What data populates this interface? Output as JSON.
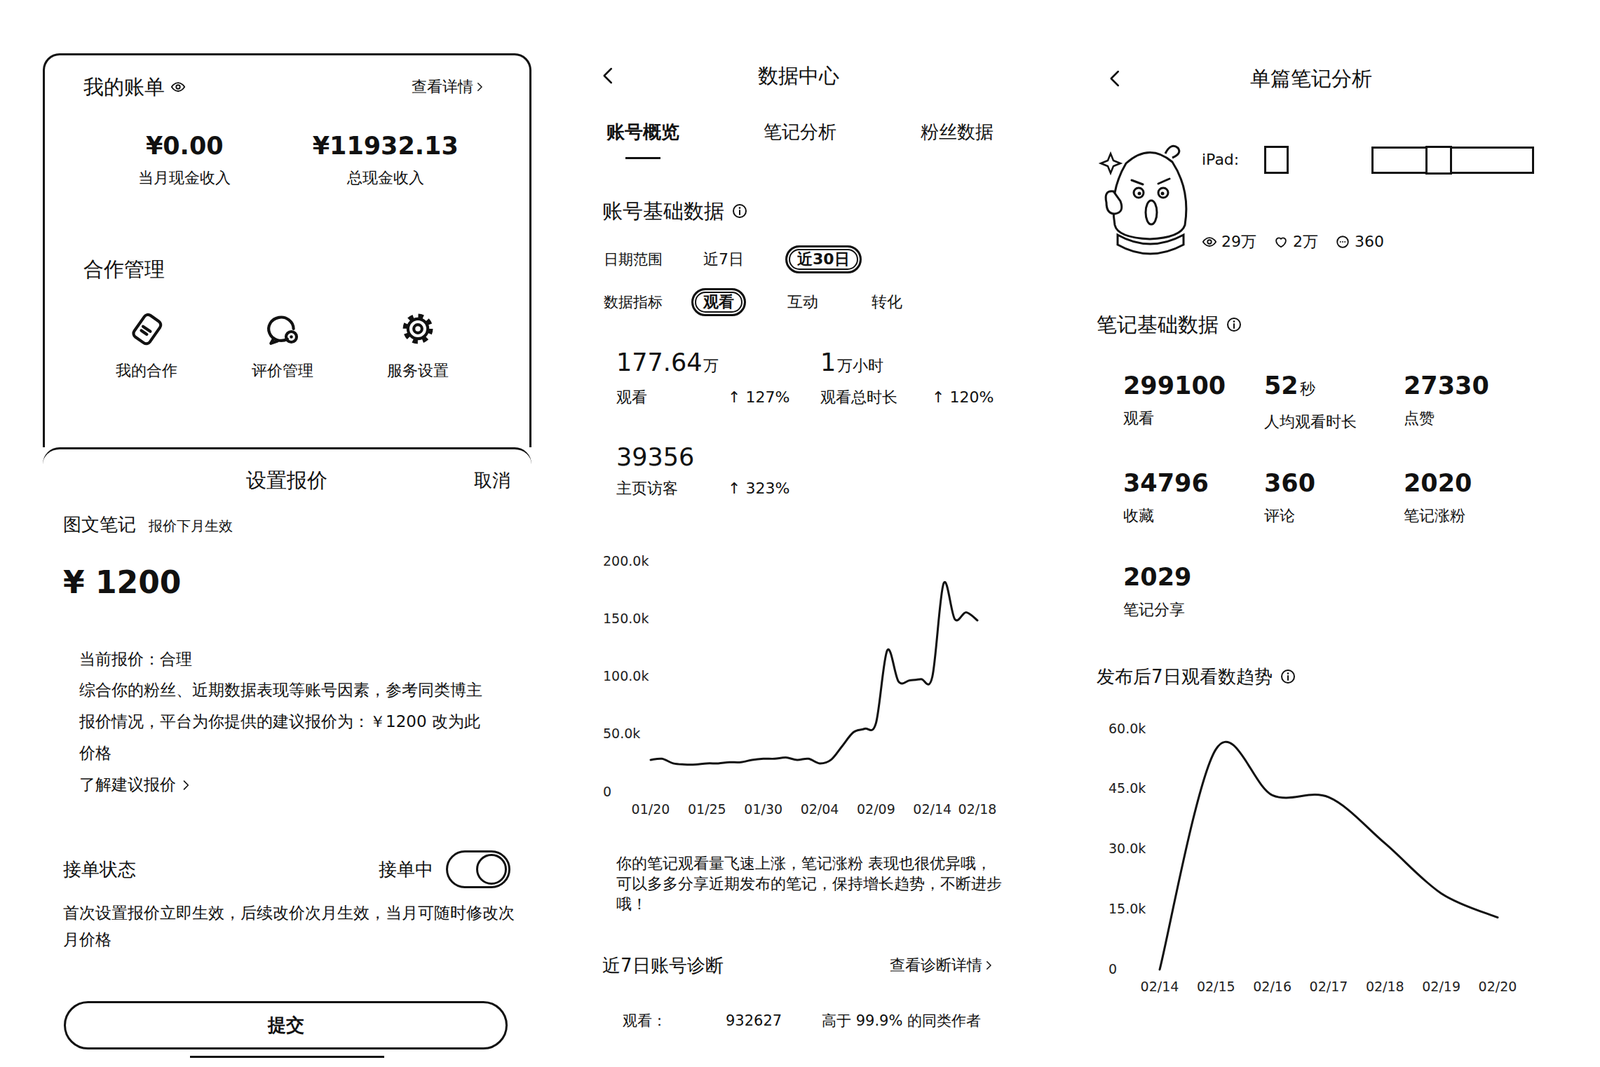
{
  "bill": {
    "title": "我的账单",
    "detail_link": "查看详情",
    "stats": [
      {
        "value": "¥0.00",
        "label": "当月现金收入"
      },
      {
        "value": "¥11932.13",
        "label": "总现金收入"
      }
    ],
    "section_title": "合作管理",
    "actions": [
      {
        "label": "我的合作"
      },
      {
        "label": "评价管理"
      },
      {
        "label": "服务设置"
      }
    ]
  },
  "quote_sheet": {
    "title": "设置报价",
    "cancel": "取消",
    "note_type": "图文笔记",
    "note_type_hint": "报价下月生效",
    "price": "¥ 1200",
    "assessment": "当前报价：合理",
    "suggestion": "综合你的粉丝、近期数据表现等账号因素，参考同类博主报价情况，平台为你提供的建议报价为：￥1200 ",
    "apply_link": "改为此价格",
    "learn_link": "了解建议报价",
    "order_status_label": "接单状态",
    "order_status_text": "接单中",
    "accepting_orders": true,
    "rule": "首次设置报价立即生效，后续改价次月生效，当月可随时修改次月价格",
    "submit": "提交"
  },
  "data_center": {
    "title": "数据中心",
    "tabs": [
      {
        "label": "账号概览",
        "selected": true
      },
      {
        "label": "笔记分析",
        "selected": false
      },
      {
        "label": "粉丝数据",
        "selected": false
      }
    ],
    "section_title": "账号基础数据",
    "date_range": {
      "label": "日期范围",
      "options": [
        {
          "label": "近7日",
          "selected": false
        },
        {
          "label": "近30日",
          "selected": true
        }
      ]
    },
    "metric": {
      "label": "数据指标",
      "options": [
        {
          "label": "观看",
          "selected": true
        },
        {
          "label": "互动",
          "selected": false
        },
        {
          "label": "转化",
          "selected": false
        }
      ]
    },
    "stats": [
      {
        "value": "177.64",
        "unit": "万",
        "label": "观看",
        "change": "↑ 127%"
      },
      {
        "value": "1",
        "unit": "万小时",
        "label": "观看总时长",
        "change": "↑ 120%"
      },
      {
        "value": "39356",
        "label": "主页访客",
        "change": "↑ 323%"
      }
    ],
    "chart": {
      "y_ticks": [
        "200.0k",
        "150.0k",
        "100.0k",
        "50.0k",
        "0"
      ],
      "x_ticks": [
        "01/20",
        "01/25",
        "01/30",
        "02/04",
        "02/09",
        "02/14",
        "02/18"
      ],
      "values": [
        28,
        29,
        25,
        24,
        24,
        25,
        25,
        26,
        26,
        28,
        29,
        29,
        30,
        28,
        29,
        25,
        28,
        40,
        52,
        55,
        60,
        123,
        96,
        97,
        98,
        100,
        181,
        150,
        156,
        149
      ]
    },
    "summary": "你的笔记观看量飞速上涨，笔记涨粉 表现也很优异哦，可以多多分享近期发布的笔记，保持增长趋势，不断进步哦！",
    "diagnosis": {
      "title": "近7日账号诊断",
      "link": "查看诊断详情",
      "rows": [
        {
          "metric": "观看：",
          "value": "932627",
          "comparison": "高于 99.9% 的同类作者"
        }
      ]
    }
  },
  "note_analysis": {
    "title": "单篇笔记分析",
    "note": {
      "title": "iPad:",
      "counts": [
        {
          "value": "29万"
        },
        {
          "value": "2万"
        },
        {
          "value": "360"
        }
      ]
    },
    "section_title": "笔记基础数据",
    "metrics": [
      {
        "value": "299100",
        "label": "观看"
      },
      {
        "value": "52",
        "unit": "秒",
        "label": "人均观看时长"
      },
      {
        "value": "27330",
        "label": "点赞"
      },
      {
        "value": "34796",
        "label": "收藏"
      },
      {
        "value": "360",
        "label": "评论"
      },
      {
        "value": "2020",
        "label": "笔记涨粉"
      },
      {
        "value": "2029",
        "label": "笔记分享"
      }
    ],
    "trend": {
      "title": "发布后7日观看数趋势",
      "y_ticks": [
        "60.0k",
        "45.0k",
        "30.0k",
        "15.0k",
        "0"
      ],
      "x_ticks": [
        "02/14",
        "02/15",
        "02/16",
        "02/17",
        "02/18",
        "02/19",
        "02/20"
      ],
      "values": [
        0,
        55,
        43.5,
        43,
        31.5,
        19,
        13
      ]
    }
  }
}
